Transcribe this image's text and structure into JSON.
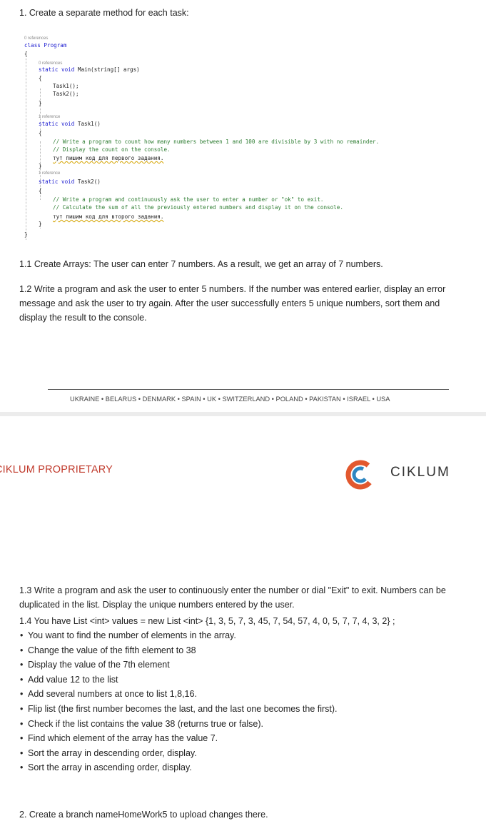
{
  "heading1": "1. Create a separate method for each task:",
  "code": {
    "ref0_a": "0 references",
    "line_class": "class Program",
    "brace_open_outer": "{",
    "ref0_b": "0 references",
    "line_main_kw": "static void",
    "line_main_rest": "Main(string[] args)",
    "brace_open_main": "{",
    "call1": "Task1();",
    "call2": "Task2();",
    "brace_close_main": "}",
    "ref1_a": "1 reference",
    "line_task1_kw": "static void",
    "line_task1_rest": "Task1()",
    "brace_open_t1": "{",
    "t1_c1": "// Write a program to count how many numbers between 1 and 100 are divisible by 3 with no remainder.",
    "t1_c2": "// Display the count on the console.",
    "t1_ru": "тут пишим код для первого задания.",
    "brace_close_t1": "}",
    "ref1_b": "1 reference",
    "line_task2_kw": "static void",
    "line_task2_rest": "Task2()",
    "brace_open_t2": "{",
    "t2_c1": "// Write a program and continuously ask the user to enter a number or \"ok\" to exit.",
    "t2_c2": "// Calculate the sum of all the previously entered numbers and display it on the console.",
    "t2_ru": "тут пишим код для второго задания.",
    "brace_close_t2": "}",
    "brace_close_outer": "}"
  },
  "p11": "1.1 Create Arrays: The user can enter 7 numbers. As a result, we get an array of 7 numbers.",
  "p12": "1.2 Write a program and ask the user to enter 5 numbers. If the number was entered earlier, display an error message and ask the user to try again. After the user successfully enters 5 unique numbers, sort them and display the result to the console.",
  "countries": "UKRAINE • BELARUS • DENMARK • SPAIN • UK • SWITZERLAND • POLAND • PAKISTAN • ISRAEL • USA",
  "proprietary": "CIKLUM PROPRIETARY",
  "logo_text": "CIKLUM",
  "colors": {
    "brand_orange": "#e2582e",
    "brand_blue": "#2e86c1",
    "proprietary_red": "#c0392b"
  },
  "p13": "1.3 Write a program and ask the user to continuously enter the number or dial \"Exit\" to exit. Numbers can be duplicated in the list. Display the unique numbers entered by the user.",
  "p14": "1.4 You have List <int> values = new List <int> {1, 3, 5, 7, 3, 45, 7, 54, 57, 4, 0, 5, 7, 7, 4, 3, 2} ;",
  "bullets": [
    "You want to find the number of elements in the array.",
    "Change the value of the fifth element to 38",
    "Display the value of the 7th element",
    "Add value 12 to the list",
    "Add several numbers at once to list 1,8,16.",
    "Flip list (the first number becomes the last, and the last one becomes the first).",
    "Check if the list contains the value 38 (returns true or false).",
    "Find which element of the array has the value 7.",
    "Sort the array in descending order, display.",
    "Sort the array in ascending order, display."
  ],
  "p2": "2. Create a branch nameHomeWork5 to upload changes there."
}
